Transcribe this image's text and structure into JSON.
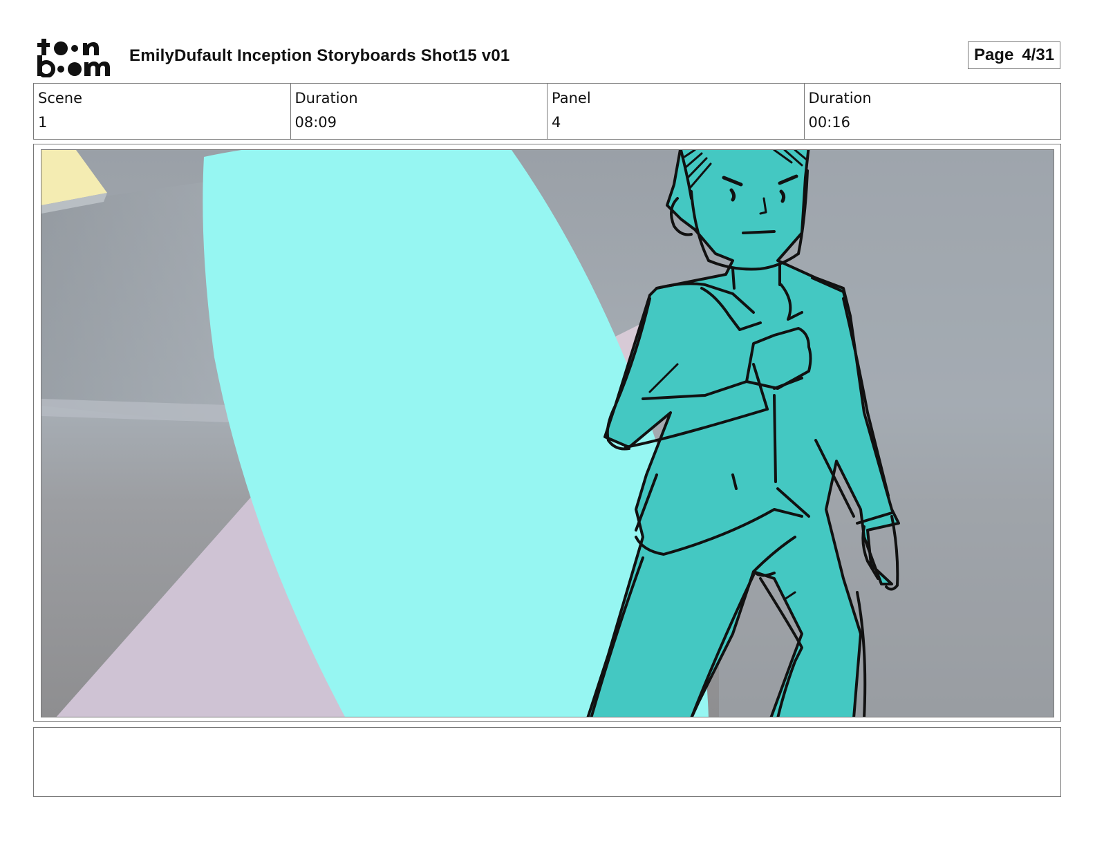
{
  "header": {
    "logo_line1": "toon",
    "logo_line2": "boom",
    "title": "EmilyDufault Inception Storyboards Shot15 v01",
    "page_label": "Page",
    "page_value": "4/31"
  },
  "info": {
    "scene_label": "Scene",
    "scene_value": "1",
    "scene_duration_label": "Duration",
    "scene_duration_value": "08:09",
    "panel_label": "Panel",
    "panel_value": "4",
    "panel_duration_label": "Duration",
    "panel_duration_value": "00:16"
  },
  "panel": {
    "colors": {
      "background_gray": "#a4abb2",
      "column_cyan": "#96f6f2",
      "character_teal": "#44c8c2",
      "floor_lilac": "#cfc3d4",
      "yellow_accent": "#f6eeb0",
      "line_art": "#111111"
    }
  },
  "notes": {
    "text": ""
  }
}
